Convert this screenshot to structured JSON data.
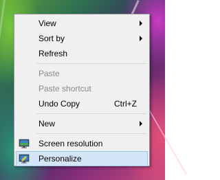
{
  "context_menu": {
    "items": [
      {
        "label": "View",
        "submenu": true
      },
      {
        "label": "Sort by",
        "submenu": true
      },
      {
        "label": "Refresh"
      },
      {
        "label": "Paste",
        "disabled": true
      },
      {
        "label": "Paste shortcut",
        "disabled": true
      },
      {
        "label": "Undo Copy",
        "shortcut": "Ctrl+Z"
      },
      {
        "label": "New",
        "submenu": true
      },
      {
        "label": "Screen resolution",
        "icon": "monitor-icon"
      },
      {
        "label": "Personalize",
        "icon": "personalize-icon",
        "highlighted": true
      }
    ]
  },
  "colors": {
    "menu_background": "#f0f0f0",
    "highlight": "#d4e5f7",
    "highlight_border": "#9fc3ea",
    "disabled_text": "#8a8a8a"
  }
}
